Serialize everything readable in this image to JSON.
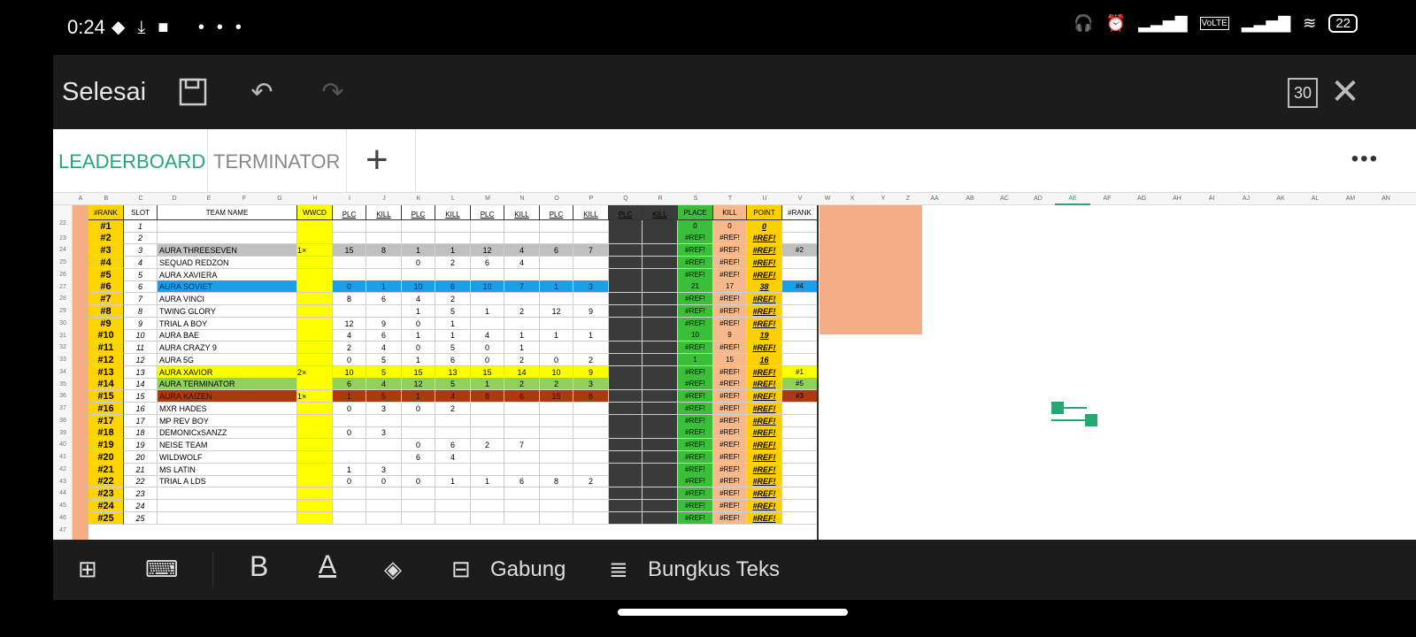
{
  "status_bar": {
    "time": "0:24",
    "battery": "22"
  },
  "toolbar": {
    "done_label": "Selesai",
    "zoom_badge": "30"
  },
  "tabs": [
    {
      "label": "LEADERBOARD",
      "active": true
    },
    {
      "label": "TERMINATOR",
      "active": false
    }
  ],
  "sheet": {
    "col_letters": [
      "A",
      "B",
      "C",
      "D",
      "E",
      "F",
      "G",
      "H",
      "I",
      "J",
      "K",
      "L",
      "M",
      "N",
      "O",
      "P",
      "Q",
      "R",
      "S",
      "T",
      "U",
      "V",
      "W",
      "X",
      "Y",
      "Z",
      "AA",
      "AB",
      "AC",
      "AD",
      "AE",
      "AF",
      "AG",
      "AH",
      "AI",
      "AJ",
      "AK",
      "AL",
      "AM",
      "AN"
    ],
    "selected_col": "AE",
    "headers": {
      "rank": "#RANK",
      "slot": "SLOT",
      "team_name": "TEAM NAME",
      "wwcd": "WWCD",
      "plc": "PLC",
      "kill": "KILL",
      "total_place": "PLACE",
      "total_kill": "KILL",
      "total_point": "POINT",
      "rank2": "#RANK"
    },
    "rows": [
      {
        "rn": "23",
        "rank": "#1",
        "slot": "1",
        "team": "",
        "wwcd": "",
        "m": [
          "",
          "",
          "",
          "",
          "",
          "",
          "",
          "",
          "",
          ""
        ],
        "tp": "0",
        "tk": "0",
        "pt": "0",
        "r2": "",
        "color": ""
      },
      {
        "rn": "24",
        "rank": "#2",
        "slot": "2",
        "team": "",
        "wwcd": "",
        "m": [
          "",
          "",
          "",
          "",
          "",
          "",
          "",
          "",
          "",
          ""
        ],
        "tp": "#REF!",
        "tk": "#REF!",
        "pt": "#REF!",
        "r2": "",
        "color": ""
      },
      {
        "rn": "25",
        "rank": "#3",
        "slot": "3",
        "team": "AURA THREESEVEN",
        "wwcd": "1×",
        "m": [
          "15",
          "8",
          "1",
          "1",
          "12",
          "4",
          "6",
          "7",
          "",
          ""
        ],
        "tp": "#REF!",
        "tk": "#REF!",
        "pt": "#REF!",
        "r2": "#2",
        "color": "gray"
      },
      {
        "rn": "26",
        "rank": "#4",
        "slot": "4",
        "team": "SEQUAD REDZON",
        "wwcd": "",
        "m": [
          "",
          "",
          "0",
          "2",
          "6",
          "4",
          "",
          "",
          "",
          ""
        ],
        "tp": "#REF!",
        "tk": "#REF!",
        "pt": "#REF!",
        "r2": "",
        "color": ""
      },
      {
        "rn": "27",
        "rank": "#5",
        "slot": "5",
        "team": "AURA XAVIERA",
        "wwcd": "",
        "m": [
          "",
          "",
          "",
          "",
          "",
          "",
          "",
          "",
          "",
          ""
        ],
        "tp": "#REF!",
        "tk": "#REF!",
        "pt": "#REF!",
        "r2": "",
        "color": ""
      },
      {
        "rn": "28",
        "rank": "#6",
        "slot": "6",
        "team": "AURA SOVIET",
        "wwcd": "",
        "m": [
          "0",
          "1",
          "10",
          "6",
          "10",
          "7",
          "1",
          "3",
          "",
          ""
        ],
        "tp": "21",
        "tk": "17",
        "pt": "38",
        "r2": "#4",
        "color": "blue"
      },
      {
        "rn": "29",
        "rank": "#7",
        "slot": "7",
        "team": "AURA VINCI",
        "wwcd": "",
        "m": [
          "8",
          "6",
          "4",
          "2",
          "",
          "",
          "",
          "",
          "",
          ""
        ],
        "tp": "#REF!",
        "tk": "#REF!",
        "pt": "#REF!",
        "r2": "",
        "color": ""
      },
      {
        "rn": "30",
        "rank": "#8",
        "slot": "8",
        "team": "TWING GLORY",
        "wwcd": "",
        "m": [
          "",
          "",
          "1",
          "5",
          "1",
          "2",
          "12",
          "9",
          "",
          ""
        ],
        "tp": "#REF!",
        "tk": "#REF!",
        "pt": "#REF!",
        "r2": "",
        "color": ""
      },
      {
        "rn": "31",
        "rank": "#9",
        "slot": "9",
        "team": "TRIAL A BOY",
        "wwcd": "",
        "m": [
          "12",
          "9",
          "0",
          "1",
          "",
          "",
          "",
          "",
          "",
          ""
        ],
        "tp": "#REF!",
        "tk": "#REF!",
        "pt": "#REF!",
        "r2": "",
        "color": ""
      },
      {
        "rn": "32",
        "rank": "#10",
        "slot": "10",
        "team": "AURA BAE",
        "wwcd": "",
        "m": [
          "4",
          "6",
          "1",
          "1",
          "4",
          "1",
          "1",
          "1",
          "",
          ""
        ],
        "tp": "10",
        "tk": "9",
        "pt": "19",
        "r2": "",
        "color": ""
      },
      {
        "rn": "33",
        "rank": "#11",
        "slot": "11",
        "team": "AURA CRAZY 9",
        "wwcd": "",
        "m": [
          "2",
          "4",
          "0",
          "5",
          "0",
          "1",
          "",
          "",
          "",
          ""
        ],
        "tp": "#REF!",
        "tk": "#REF!",
        "pt": "#REF!",
        "r2": "",
        "color": ""
      },
      {
        "rn": "34",
        "rank": "#12",
        "slot": "12",
        "team": "AURA 5G",
        "wwcd": "",
        "m": [
          "0",
          "5",
          "1",
          "6",
          "0",
          "2",
          "0",
          "2",
          "",
          ""
        ],
        "tp": "1",
        "tk": "15",
        "pt": "16",
        "r2": "",
        "color": ""
      },
      {
        "rn": "35",
        "rank": "#13",
        "slot": "13",
        "team": "AURA XAVIOR",
        "wwcd": "2×",
        "m": [
          "10",
          "5",
          "15",
          "13",
          "15",
          "14",
          "10",
          "9",
          "",
          ""
        ],
        "tp": "#REF!",
        "tk": "#REF!",
        "pt": "#REF!",
        "r2": "#1",
        "color": "yellow"
      },
      {
        "rn": "36",
        "rank": "#14",
        "slot": "14",
        "team": "AURA TERMINATOR",
        "wwcd": "",
        "m": [
          "6",
          "4",
          "12",
          "5",
          "1",
          "2",
          "2",
          "3",
          "",
          ""
        ],
        "tp": "#REF!",
        "tk": "#REF!",
        "pt": "#REF!",
        "r2": "#5",
        "color": "green"
      },
      {
        "rn": "37",
        "rank": "#15",
        "slot": "15",
        "team": "AURA KAIZEN",
        "wwcd": "1×",
        "m": [
          "1",
          "5",
          "1",
          "4",
          "8",
          "6",
          "15",
          "8",
          "",
          ""
        ],
        "tp": "#REF!",
        "tk": "#REF!",
        "pt": "#REF!",
        "r2": "#3",
        "color": "brown"
      },
      {
        "rn": "38",
        "rank": "#16",
        "slot": "16",
        "team": "MXR HADES",
        "wwcd": "",
        "m": [
          "0",
          "3",
          "0",
          "2",
          "",
          "",
          "",
          "",
          "",
          ""
        ],
        "tp": "#REF!",
        "tk": "#REF!",
        "pt": "#REF!",
        "r2": "",
        "color": ""
      },
      {
        "rn": "39",
        "rank": "#17",
        "slot": "17",
        "team": "MP REV BOY",
        "wwcd": "",
        "m": [
          "",
          "",
          "",
          "",
          "",
          "",
          "",
          "",
          "",
          ""
        ],
        "tp": "#REF!",
        "tk": "#REF!",
        "pt": "#REF!",
        "r2": "",
        "color": ""
      },
      {
        "rn": "40",
        "rank": "#18",
        "slot": "18",
        "team": "DEMONICxSANZZ",
        "wwcd": "",
        "m": [
          "0",
          "3",
          "",
          "",
          "",
          "",
          "",
          "",
          "",
          ""
        ],
        "tp": "#REF!",
        "tk": "#REF!",
        "pt": "#REF!",
        "r2": "",
        "color": ""
      },
      {
        "rn": "41",
        "rank": "#19",
        "slot": "19",
        "team": "NEISE TEAM",
        "wwcd": "",
        "m": [
          "",
          "",
          "0",
          "6",
          "2",
          "7",
          "",
          "",
          "",
          ""
        ],
        "tp": "#REF!",
        "tk": "#REF!",
        "pt": "#REF!",
        "r2": "",
        "color": ""
      },
      {
        "rn": "42",
        "rank": "#20",
        "slot": "20",
        "team": "WILDWOLF",
        "wwcd": "",
        "m": [
          "",
          "",
          "6",
          "4",
          "",
          "",
          "",
          "",
          "",
          ""
        ],
        "tp": "#REF!",
        "tk": "#REF!",
        "pt": "#REF!",
        "r2": "",
        "color": ""
      },
      {
        "rn": "43",
        "rank": "#21",
        "slot": "21",
        "team": "MS LATIN",
        "wwcd": "",
        "m": [
          "1",
          "3",
          "",
          "",
          "",
          "",
          "",
          "",
          "",
          ""
        ],
        "tp": "#REF!",
        "tk": "#REF!",
        "pt": "#REF!",
        "r2": "",
        "color": ""
      },
      {
        "rn": "44",
        "rank": "#22",
        "slot": "22",
        "team": "TRIAL A LDS",
        "wwcd": "",
        "m": [
          "0",
          "0",
          "0",
          "1",
          "1",
          "6",
          "8",
          "2",
          "",
          ""
        ],
        "tp": "#REF!",
        "tk": "#REF!",
        "pt": "#REF!",
        "r2": "",
        "color": ""
      },
      {
        "rn": "45",
        "rank": "#23",
        "slot": "23",
        "team": "",
        "wwcd": "",
        "m": [
          "",
          "",
          "",
          "",
          "",
          "",
          "",
          "",
          "",
          ""
        ],
        "tp": "#REF!",
        "tk": "#REF!",
        "pt": "#REF!",
        "r2": "",
        "color": ""
      },
      {
        "rn": "46",
        "rank": "#24",
        "slot": "24",
        "team": "",
        "wwcd": "",
        "m": [
          "",
          "",
          "",
          "",
          "",
          "",
          "",
          "",
          "",
          ""
        ],
        "tp": "#REF!",
        "tk": "#REF!",
        "pt": "#REF!",
        "r2": "",
        "color": ""
      },
      {
        "rn": "47",
        "rank": "#25",
        "slot": "25",
        "team": "",
        "wwcd": "",
        "m": [
          "",
          "",
          "",
          "",
          "",
          "",
          "",
          "",
          "",
          ""
        ],
        "tp": "#REF!",
        "tk": "#REF!",
        "pt": "#REF!",
        "r2": "",
        "color": ""
      }
    ],
    "header_row_num": "22",
    "colors": {
      "rank_bg": "#ffd400",
      "wwcd_bg": "#ffff00",
      "place_bg": "#3bbf3b",
      "kill_bg": "#f7b98c",
      "point_bg": "#ffd000",
      "dark_col": "#3a3a3a",
      "orange": "#f4ae85",
      "gray": "#c0c0c0",
      "blue": "#1aa0e8",
      "yellow": "#ffff00",
      "green": "#8fd15a",
      "brown": "#a93b12"
    }
  },
  "bottom_bar": {
    "merge_label": "Gabung",
    "wrap_label": "Bungkus Teks"
  }
}
